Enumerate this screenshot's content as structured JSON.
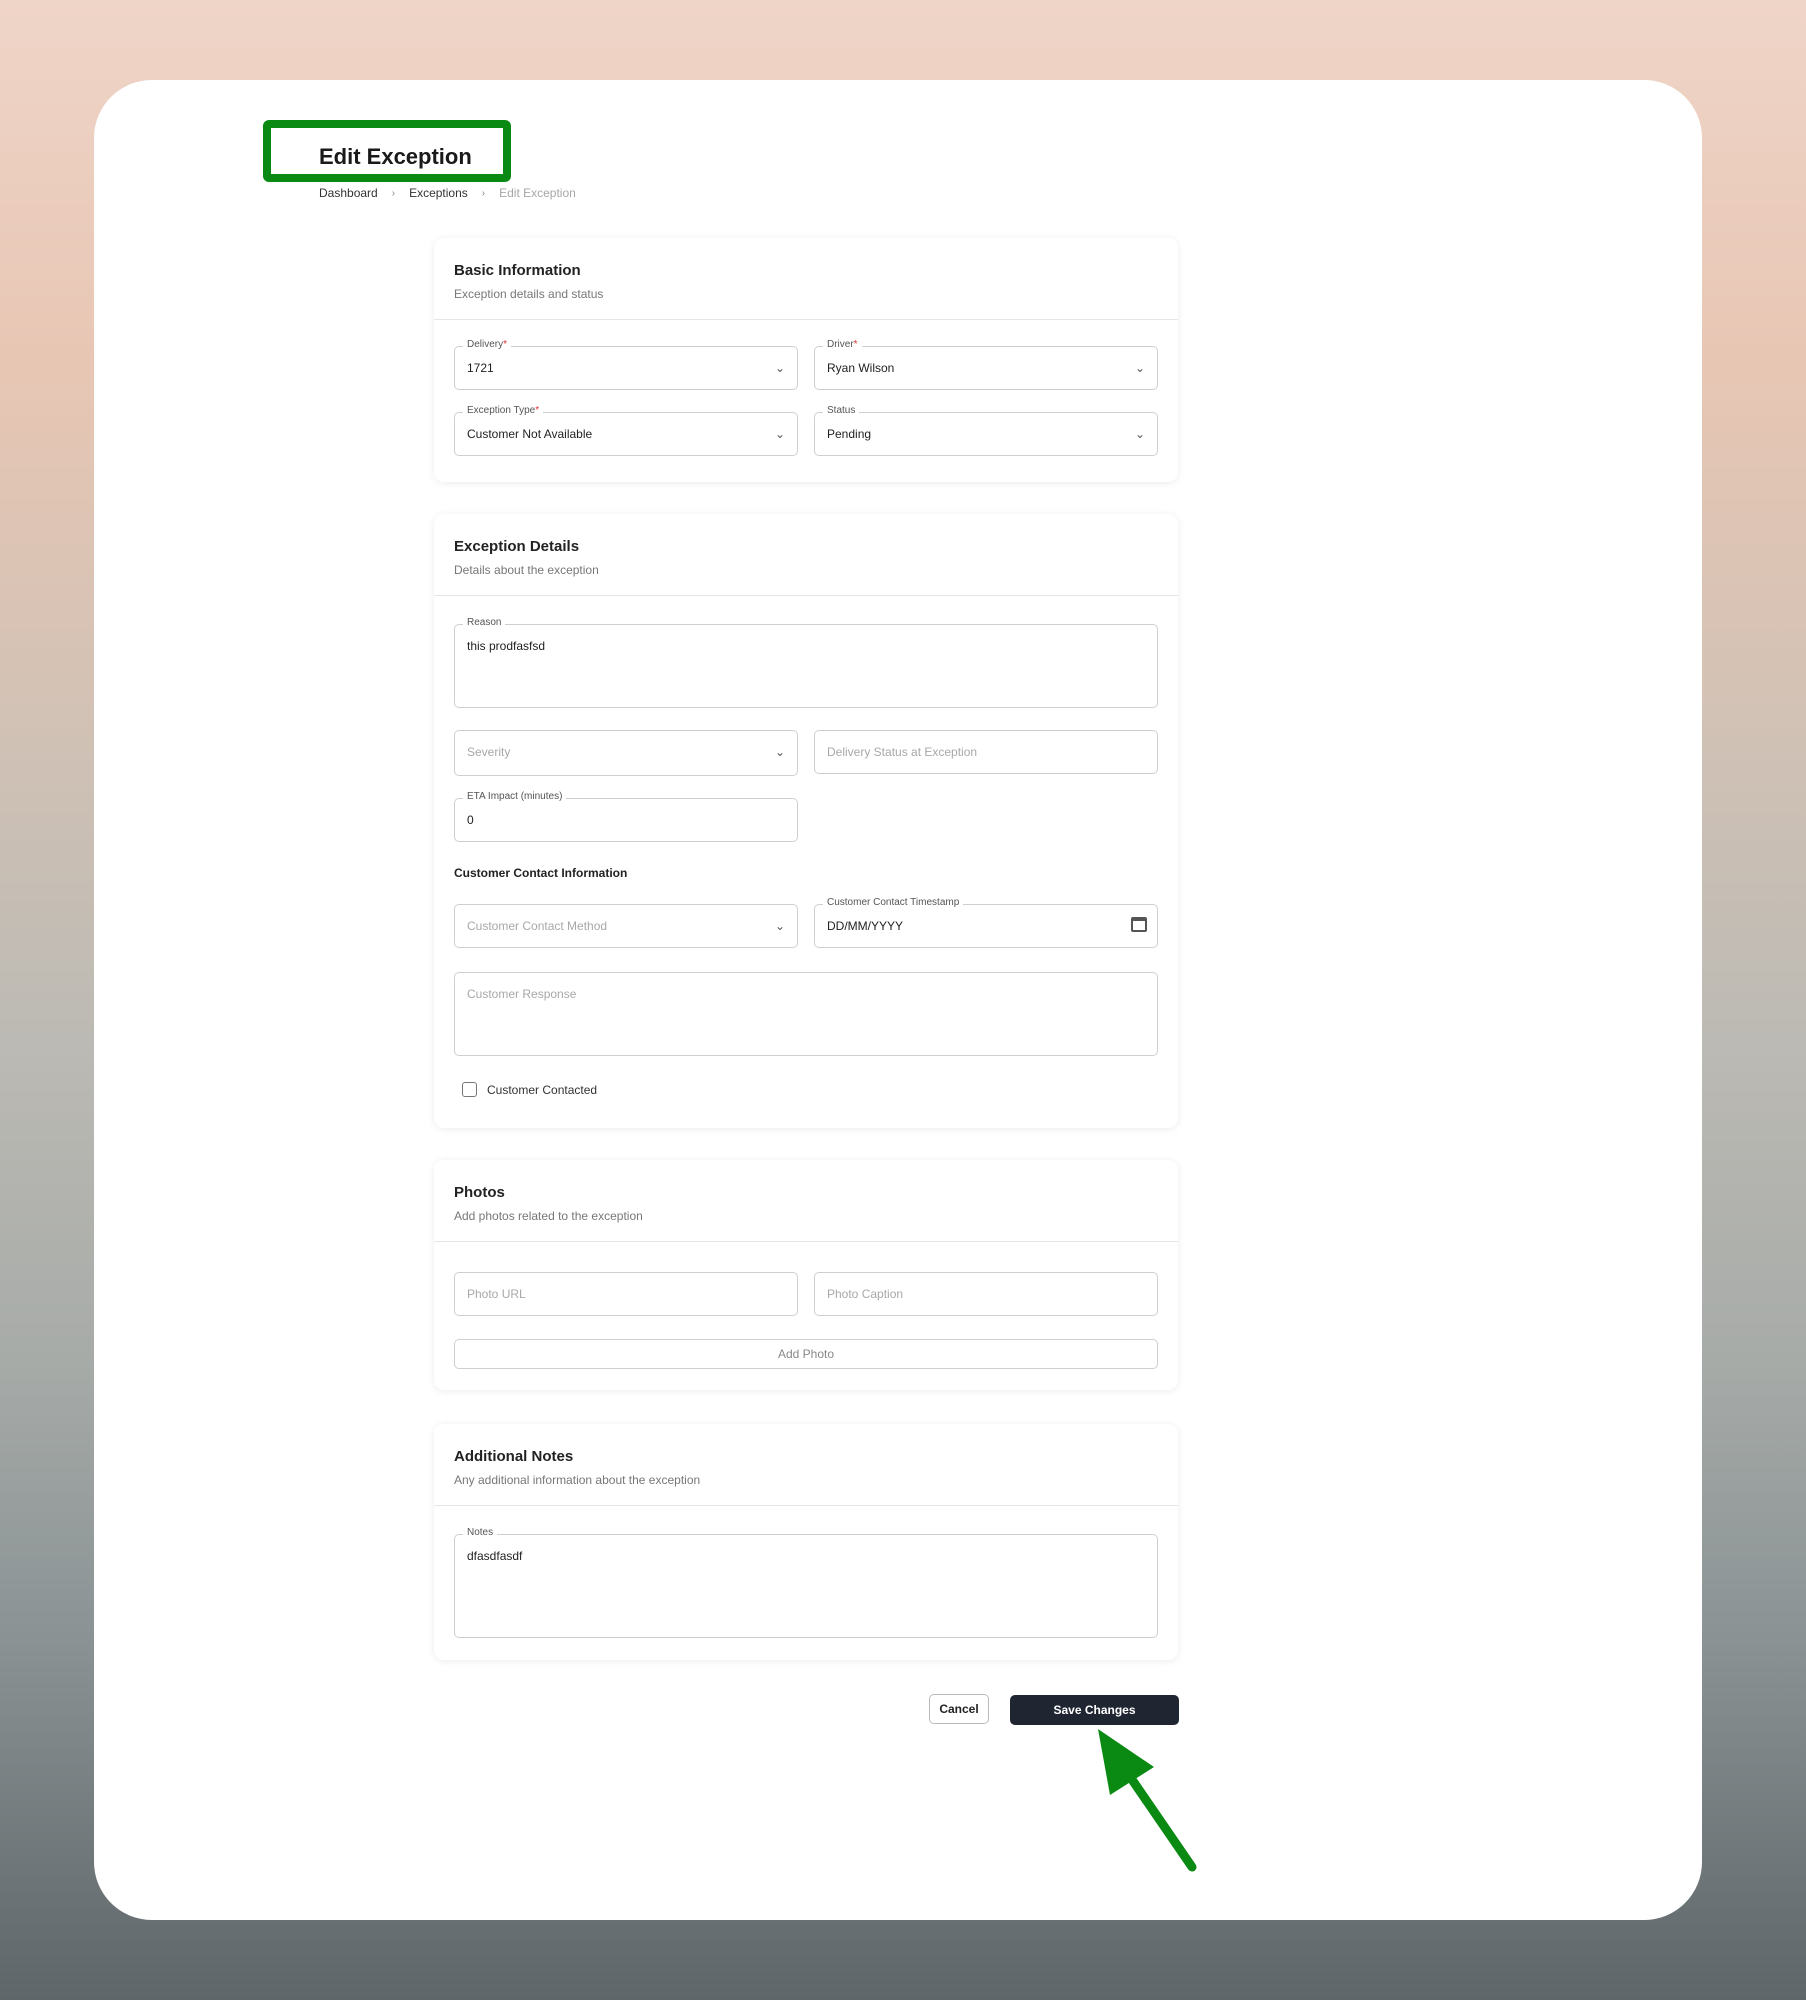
{
  "page": {
    "title": "Edit Exception",
    "breadcrumb": [
      "Dashboard",
      "Exceptions",
      "Edit Exception"
    ]
  },
  "basic": {
    "title": "Basic Information",
    "subtitle": "Exception details and status",
    "delivery": {
      "label": "Delivery",
      "value": "1721"
    },
    "driver": {
      "label": "Driver",
      "value": "Ryan Wilson"
    },
    "exception_type": {
      "label": "Exception Type",
      "value": "Customer Not Available"
    },
    "status": {
      "label": "Status",
      "value": "Pending"
    }
  },
  "details": {
    "title": "Exception Details",
    "subtitle": "Details about the exception",
    "reason": {
      "label": "Reason",
      "value": "this prodfasfsd"
    },
    "severity_placeholder": "Severity",
    "delivery_status_placeholder": "Delivery Status at Exception",
    "eta": {
      "label": "ETA Impact (minutes)",
      "value": "0"
    },
    "contact_heading": "Customer Contact Information",
    "contact_method_placeholder": "Customer Contact Method",
    "contact_timestamp": {
      "label": "Customer Contact Timestamp",
      "value": "DD/MM/YYYY"
    },
    "response_placeholder": "Customer Response",
    "contacted_label": "Customer Contacted"
  },
  "photos": {
    "title": "Photos",
    "subtitle": "Add photos related to the exception",
    "url_placeholder": "Photo URL",
    "caption_placeholder": "Photo Caption",
    "add_label": "Add Photo"
  },
  "notes": {
    "title": "Additional Notes",
    "subtitle": "Any additional information about the exception",
    "label": "Notes",
    "value": "dfasdfasdf"
  },
  "actions": {
    "cancel": "Cancel",
    "save": "Save Changes"
  },
  "colors": {
    "highlight": "#0a8a12",
    "primary_button": "#1f2531"
  },
  "icons": [
    "chevron-down-icon",
    "calendar-icon",
    "arrow-pointer-icon"
  ]
}
